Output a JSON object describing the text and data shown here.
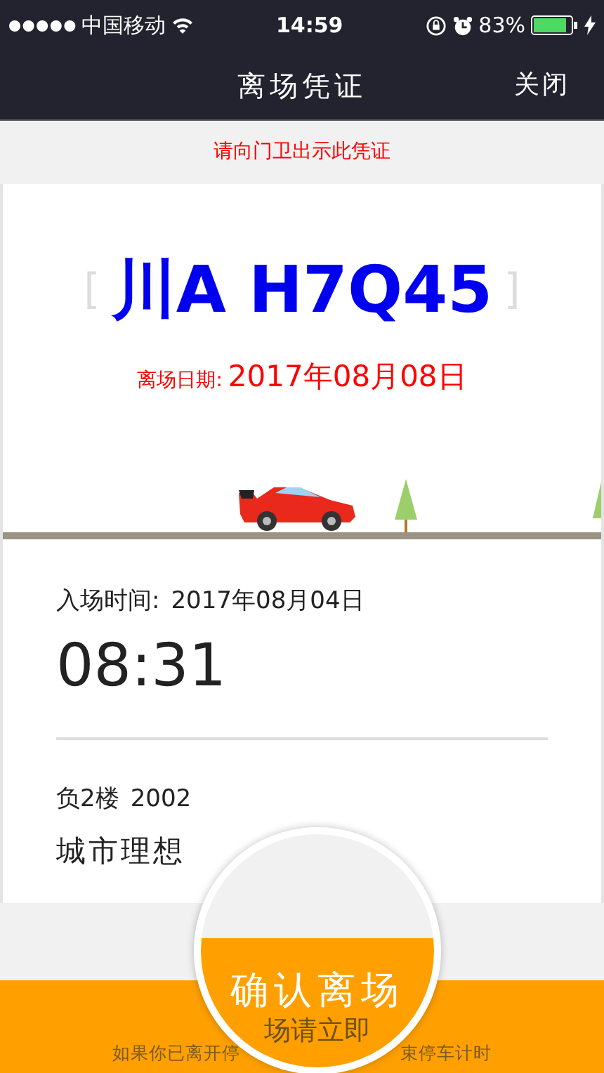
{
  "status_bar": {
    "carrier": "中国移动",
    "time": "14:59",
    "battery": "83%"
  },
  "nav": {
    "title": "离场凭证",
    "close": "关闭"
  },
  "notice": "请向门卫出示此凭证",
  "plate": {
    "province": "川A",
    "number": "H7Q45",
    "bracket_left": "[",
    "bracket_right": "]"
  },
  "exit_date": {
    "label": "离场日期:",
    "value": "2017年08月08日"
  },
  "entry": {
    "label": "入场时间:",
    "date": "2017年08月04日",
    "time": "08:31"
  },
  "location": {
    "floor": "负2楼",
    "space": "2002",
    "lot": "城市理想"
  },
  "confirm_button": {
    "label": "确认离场",
    "magnified_note": "场请立即"
  },
  "footer_note": {
    "left": "如果你已离开停",
    "right": "束停车计时"
  }
}
